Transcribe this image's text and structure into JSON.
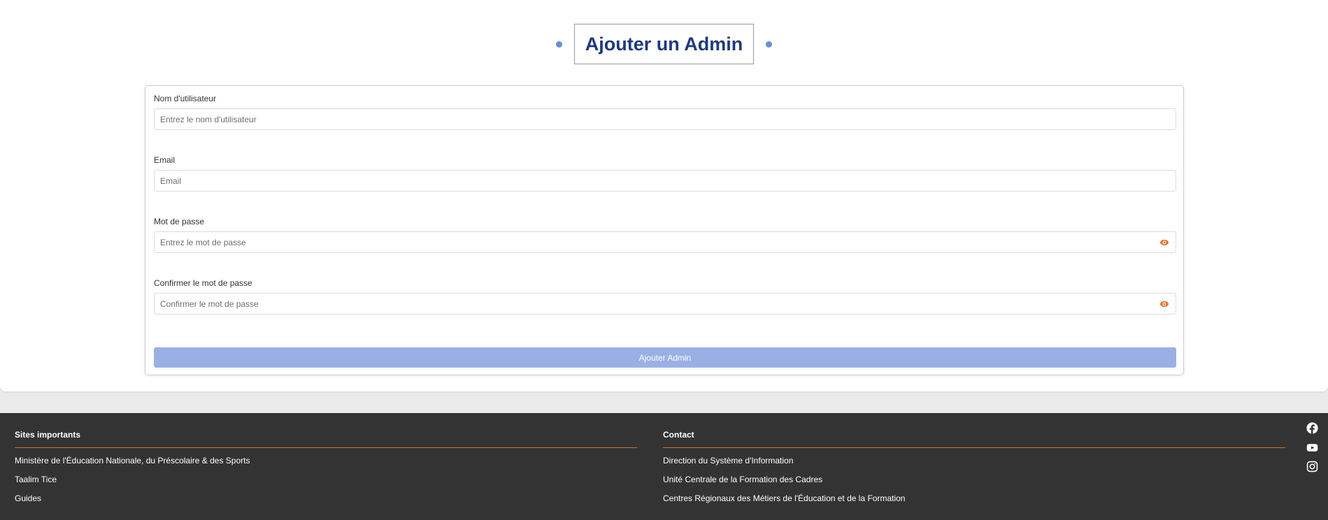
{
  "form": {
    "title": "Ajouter un Admin",
    "fields": [
      {
        "label": "Nom d'utilisateur",
        "placeholder": "Entrez le nom d'utilisateur",
        "value": ""
      },
      {
        "label": "Email",
        "placeholder": "Email",
        "value": ""
      },
      {
        "label": "Mot de passe",
        "placeholder": "Entrez le mot de passe",
        "value": ""
      },
      {
        "label": "Confirmer le mot de passe",
        "placeholder": "Confirmer le mot de passe",
        "value": ""
      }
    ],
    "submit_label": "Ajouter Admin"
  },
  "footer": {
    "sites": {
      "heading": "Sites importants",
      "links": [
        "Ministère de l'Éducation Nationale, du Préscolaire & des Sports",
        "Taalim Tice",
        "Guides"
      ]
    },
    "contact": {
      "heading": "Contact",
      "links": [
        "Direction du Système d'Information",
        "Unité Centrale de la Formation des Cadres",
        "Centres Régionaux des Métiers de l'Éducation et de la Formation"
      ]
    },
    "social_icons": [
      "facebook-icon",
      "youtube-icon",
      "instagram-icon"
    ]
  },
  "colors": {
    "title_text": "#1f3a7a",
    "dot_accent": "#6a8cd8",
    "submit_button": "#9ab0e4",
    "eye_icon": "#e8722c",
    "footer_bg": "#333333",
    "footer_divider": "#c9742b"
  },
  "icons": {
    "password_toggle": "eye-icon",
    "confirm_toggle": "eye-icon"
  }
}
